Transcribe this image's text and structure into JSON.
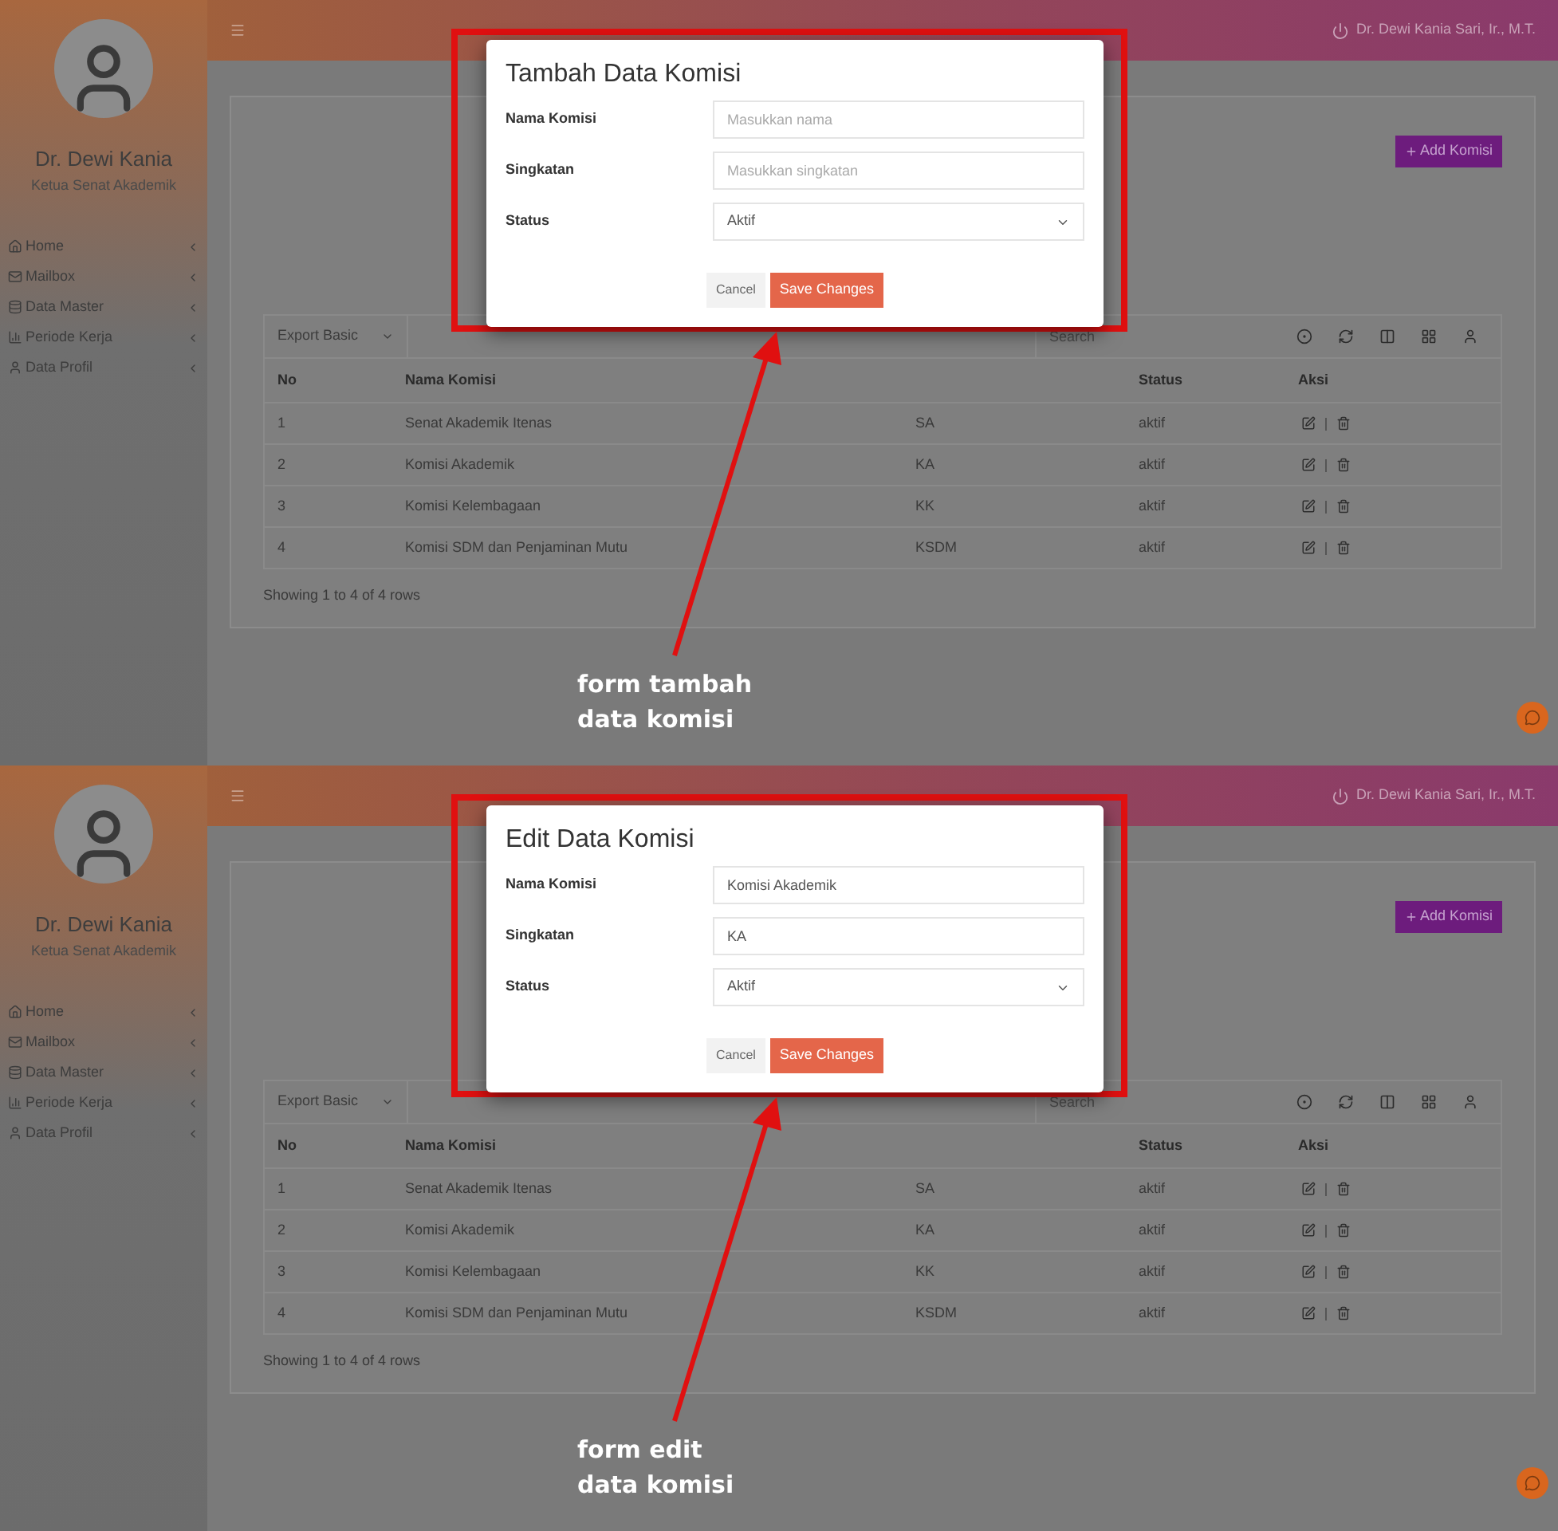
{
  "panels": [
    {
      "sidebar": {
        "name": "Dr. Dewi Kania",
        "role": "Ketua Senat Akademik",
        "items": [
          {
            "label": "Home",
            "kind": "home"
          },
          {
            "label": "Mailbox",
            "kind": "mail"
          },
          {
            "label": "Data Master",
            "kind": "data"
          },
          {
            "label": "Periode Kerja",
            "kind": "chart"
          },
          {
            "label": "Data Profil",
            "kind": "profile"
          }
        ]
      },
      "header": {
        "user": "Dr. Dewi Kania Sari, Ir., M.T."
      },
      "add_button": "Add Komisi",
      "toolbar": {
        "export": "Export Basic",
        "search_placeholder": "Search"
      },
      "table": {
        "columns": {
          "no": "No",
          "name": "Nama Komisi",
          "status": "Status",
          "actions": "Aksi"
        },
        "rows": [
          {
            "no": "1",
            "name": "Senat Akademik Itenas",
            "abbr": "SA",
            "status": "aktif"
          },
          {
            "no": "2",
            "name": "Komisi Akademik",
            "abbr": "KA",
            "status": "aktif"
          },
          {
            "no": "3",
            "name": "Komisi Kelembagaan",
            "abbr": "KK",
            "status": "aktif"
          },
          {
            "no": "4",
            "name": "Komisi SDM dan Penjaminan Mutu",
            "abbr": "KSDM",
            "status": "aktif"
          }
        ],
        "footer": "Showing 1 to 4 of 4 rows"
      },
      "modal": {
        "title": "Tambah Data Komisi",
        "fields": [
          {
            "label": "Nama Komisi",
            "kind": "text",
            "placeholder": "Masukkan nama"
          },
          {
            "label": "Singkatan",
            "kind": "text",
            "placeholder": "Masukkan singkatan"
          },
          {
            "label": "Status",
            "kind": "select",
            "value": "Aktif"
          }
        ],
        "cancel": "Cancel",
        "save": "Save Changes"
      },
      "annotation": [
        "form tambah",
        "data komisi"
      ]
    },
    {
      "sidebar": {
        "name": "Dr. Dewi Kania",
        "role": "Ketua Senat Akademik",
        "items": [
          {
            "label": "Home",
            "kind": "home"
          },
          {
            "label": "Mailbox",
            "kind": "mail"
          },
          {
            "label": "Data Master",
            "kind": "data"
          },
          {
            "label": "Periode Kerja",
            "kind": "chart"
          },
          {
            "label": "Data Profil",
            "kind": "profile"
          }
        ]
      },
      "header": {
        "user": "Dr. Dewi Kania Sari, Ir., M.T."
      },
      "add_button": "Add Komisi",
      "toolbar": {
        "export": "Export Basic",
        "search_placeholder": "Search"
      },
      "table": {
        "columns": {
          "no": "No",
          "name": "Nama Komisi",
          "status": "Status",
          "actions": "Aksi"
        },
        "rows": [
          {
            "no": "1",
            "name": "Senat Akademik Itenas",
            "abbr": "SA",
            "status": "aktif"
          },
          {
            "no": "2",
            "name": "Komisi Akademik",
            "abbr": "KA",
            "status": "aktif"
          },
          {
            "no": "3",
            "name": "Komisi Kelembagaan",
            "abbr": "KK",
            "status": "aktif"
          },
          {
            "no": "4",
            "name": "Komisi SDM dan Penjaminan Mutu",
            "abbr": "KSDM",
            "status": "aktif"
          }
        ],
        "footer": "Showing 1 to 4 of 4 rows"
      },
      "modal": {
        "title": "Edit Data Komisi",
        "fields": [
          {
            "label": "Nama Komisi",
            "kind": "text",
            "value": "Komisi Akademik"
          },
          {
            "label": "Singkatan",
            "kind": "text",
            "value": "KA"
          },
          {
            "label": "Status",
            "kind": "select",
            "value": "Aktif"
          }
        ],
        "cancel": "Cancel",
        "save": "Save Changes"
      },
      "annotation": [
        "form edit",
        "data komisi"
      ]
    }
  ]
}
